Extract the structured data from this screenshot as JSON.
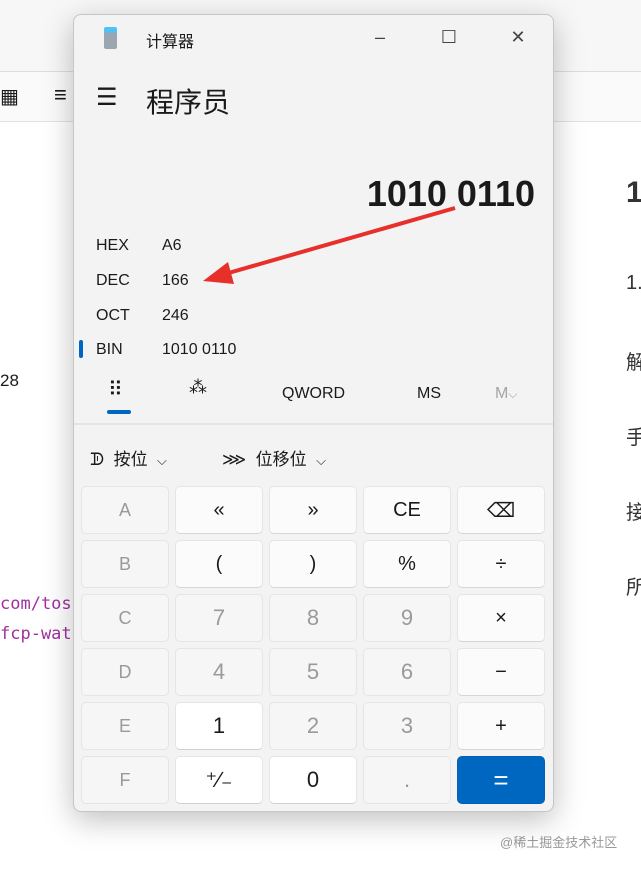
{
  "background": {
    "left_number": "28",
    "code_lines": [
      "com/tos",
      "fcp-wat"
    ],
    "right_lines": [
      "1",
      "1.",
      "解",
      "手",
      "接",
      "所"
    ],
    "watermark": "@稀土掘金技术社区"
  },
  "window": {
    "title": "计算器",
    "mode": "程序员",
    "display": "1010 0110",
    "radix": [
      {
        "label": "HEX",
        "value": "A6"
      },
      {
        "label": "DEC",
        "value": "166"
      },
      {
        "label": "OCT",
        "value": "246"
      },
      {
        "label": "BIN",
        "value": "1010 0110"
      }
    ],
    "selected_radix": "BIN",
    "tabs": {
      "word": "QWORD",
      "ms": "MS",
      "mr": "M"
    },
    "bitwise": "按位",
    "bitshift": "位移位",
    "keys": [
      {
        "l": "A",
        "t": "hex"
      },
      {
        "l": "«",
        "t": "op"
      },
      {
        "l": "»",
        "t": "op"
      },
      {
        "l": "CE",
        "t": "op"
      },
      {
        "l": "⌫",
        "t": "op"
      },
      {
        "l": "B",
        "t": "hex"
      },
      {
        "l": "(",
        "t": "op"
      },
      {
        "l": ")",
        "t": "op"
      },
      {
        "l": "%",
        "t": "op"
      },
      {
        "l": "÷",
        "t": "op"
      },
      {
        "l": "C",
        "t": "hex"
      },
      {
        "l": "7",
        "t": "dis"
      },
      {
        "l": "8",
        "t": "dis"
      },
      {
        "l": "9",
        "t": "dis"
      },
      {
        "l": "×",
        "t": "op"
      },
      {
        "l": "D",
        "t": "hex"
      },
      {
        "l": "4",
        "t": "dis"
      },
      {
        "l": "5",
        "t": "dis"
      },
      {
        "l": "6",
        "t": "dis"
      },
      {
        "l": "−",
        "t": "op"
      },
      {
        "l": "E",
        "t": "hex"
      },
      {
        "l": "1",
        "t": "num"
      },
      {
        "l": "2",
        "t": "dis"
      },
      {
        "l": "3",
        "t": "dis"
      },
      {
        "l": "+",
        "t": "op"
      },
      {
        "l": "F",
        "t": "hex"
      },
      {
        "l": "⁺∕₋",
        "t": "num"
      },
      {
        "l": "0",
        "t": "num"
      },
      {
        "l": ".",
        "t": "dis"
      },
      {
        "l": "=",
        "t": "eq"
      }
    ]
  },
  "colors": {
    "accent": "#0067c0",
    "arrow": "#e8302a"
  }
}
